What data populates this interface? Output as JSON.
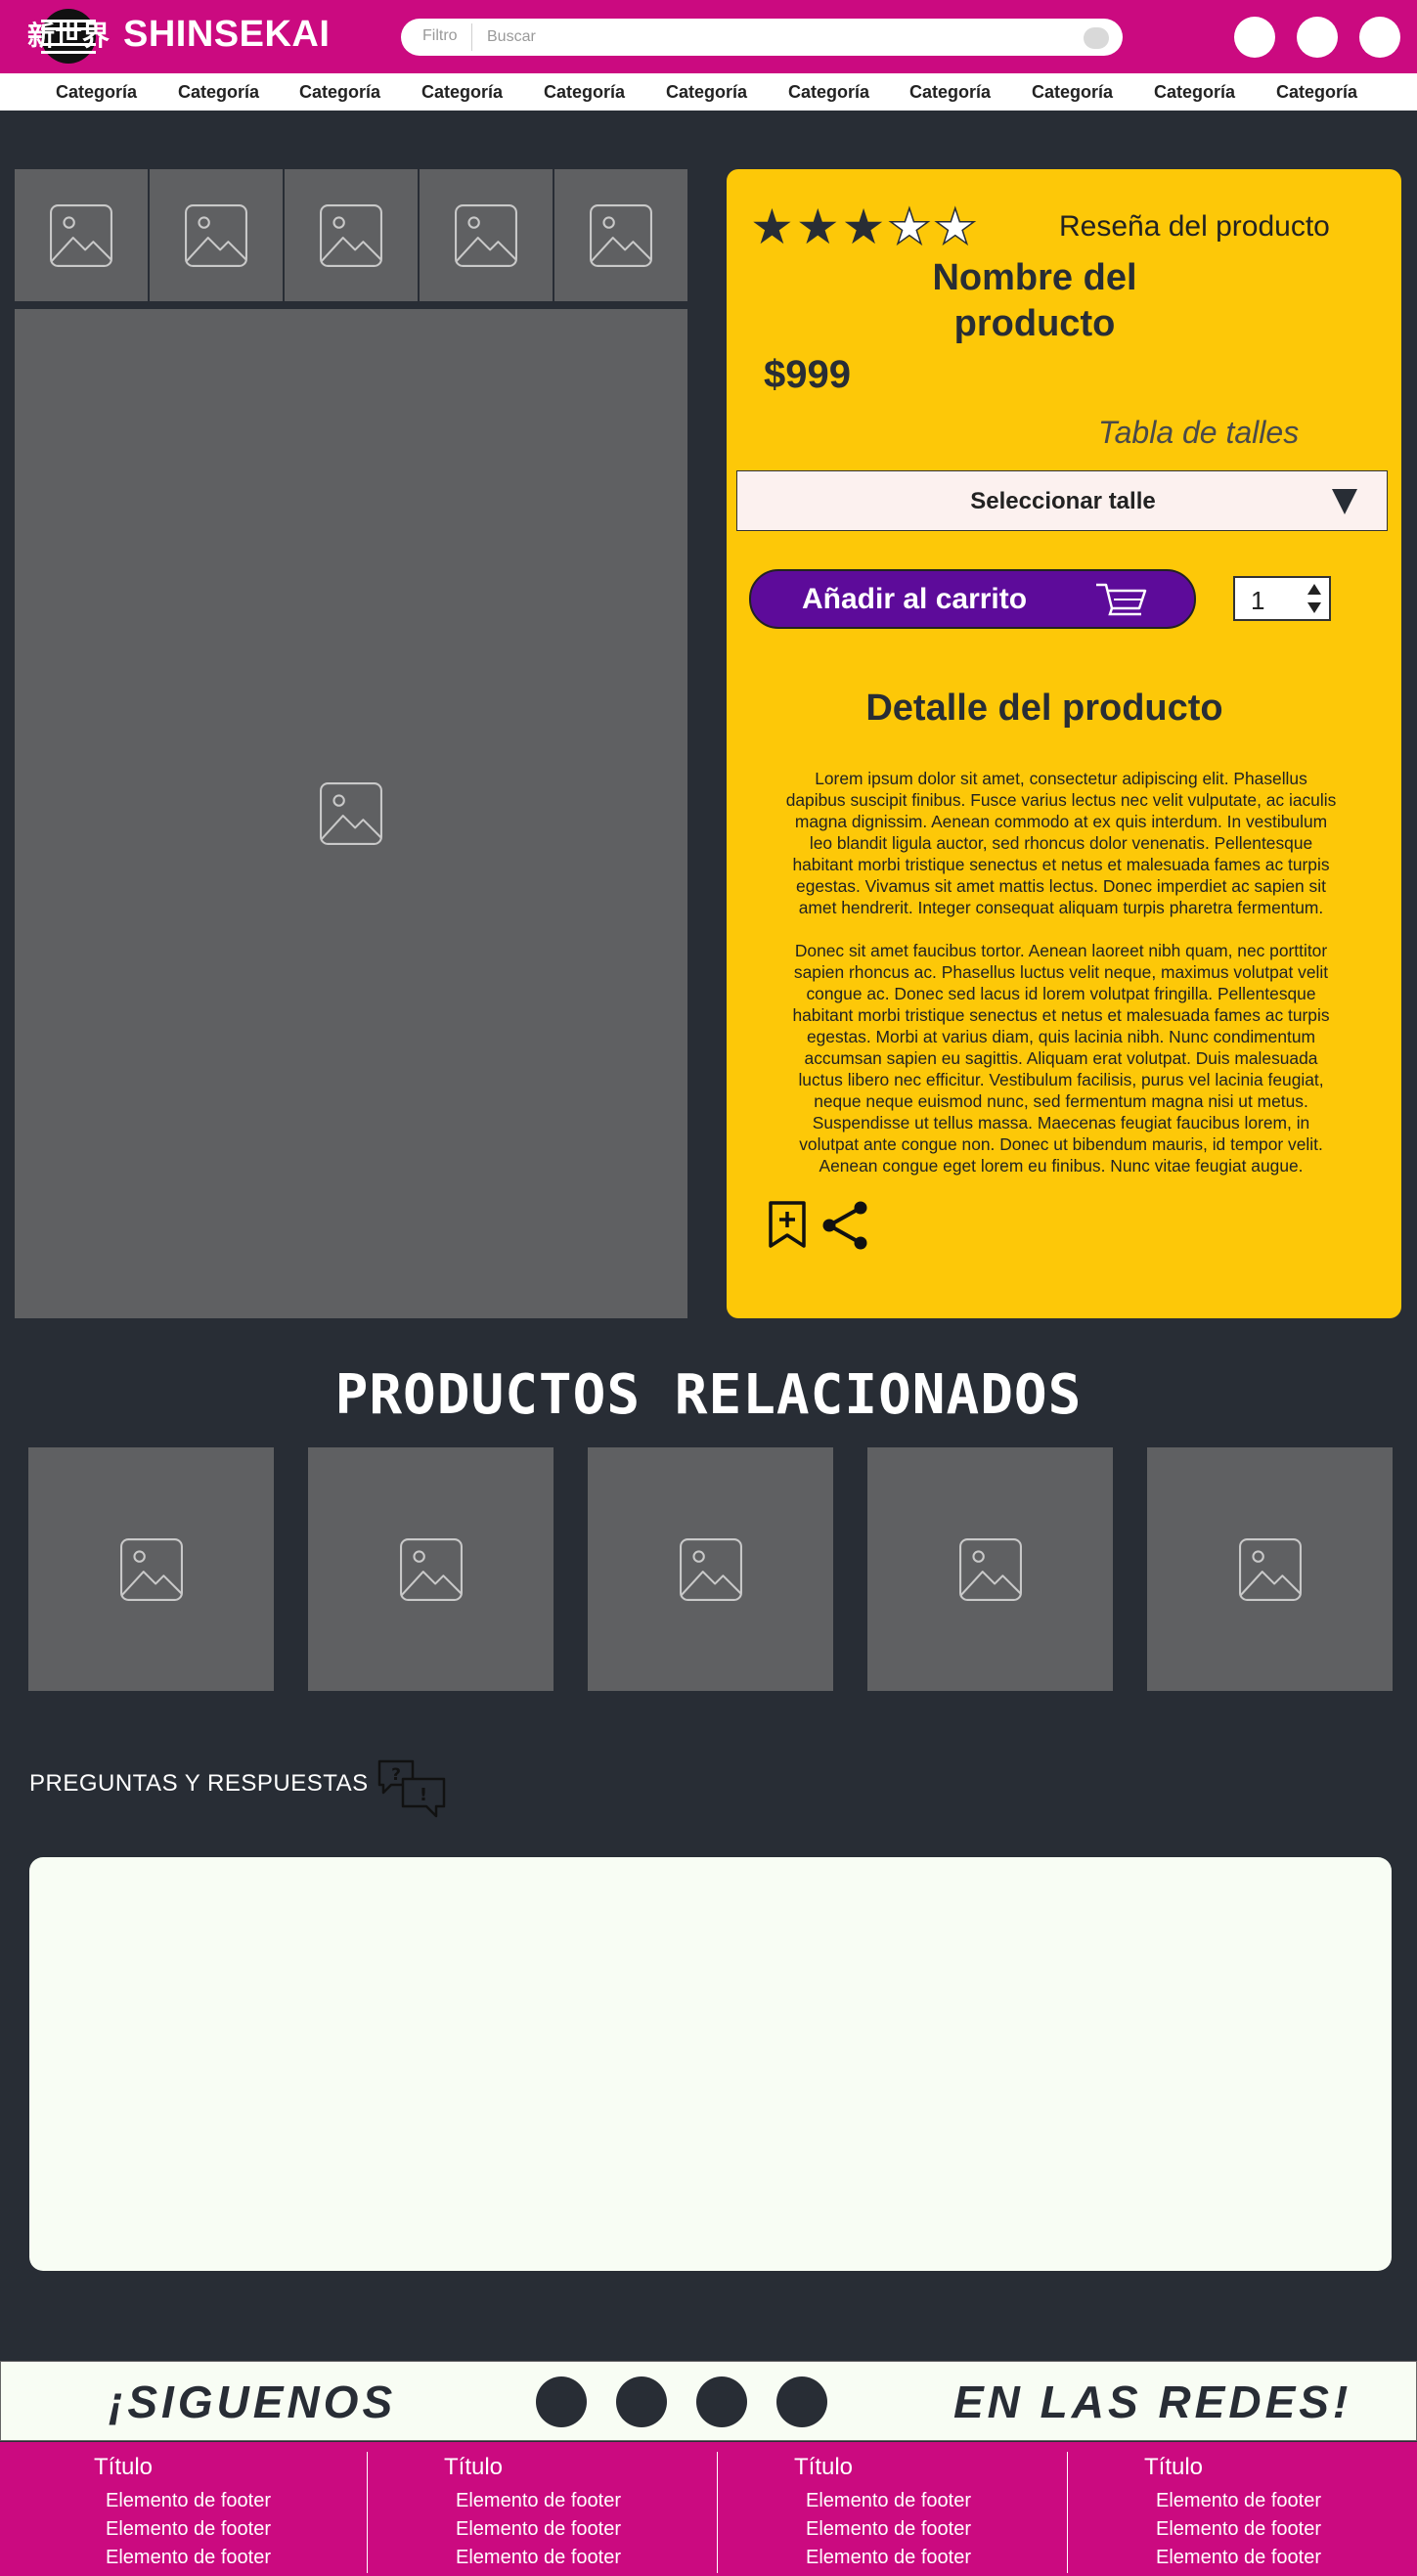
{
  "header": {
    "logo_text": "SHINSEKAI",
    "logo_kanji": "新世界",
    "search": {
      "filter_label": "Filtro",
      "placeholder": "Buscar"
    }
  },
  "categories": [
    "Categoría",
    "Categoría",
    "Categoría",
    "Categoría",
    "Categoría",
    "Categoría",
    "Categoría",
    "Categoría",
    "Categoría",
    "Categoría",
    "Categoría"
  ],
  "product": {
    "rating": 3,
    "rating_max": 5,
    "review_label": "Reseña del producto",
    "name_line1": "Nombre del",
    "name_line2": "producto",
    "price": "$999",
    "size_table": "Tabla de talles",
    "size_select": "Seleccionar talle",
    "add_to_cart": "Añadir al carrito",
    "quantity": "1",
    "detail_title": "Detalle del producto",
    "description": [
      [
        "Lorem ipsum dolor sit amet, consectetur adipiscing elit. Phasellus",
        "dapibus suscipit finibus. Fusce varius lectus nec velit vulputate, ac iaculis",
        "magna dignissim. Aenean commodo at ex quis interdum. In vestibulum",
        "leo blandit ligula auctor, sed rhoncus dolor venenatis. Pellentesque",
        "habitant morbi tristique senectus et netus et malesuada fames ac turpis",
        "egestas. Vivamus sit amet mattis lectus. Donec imperdiet ac sapien sit",
        "amet hendrerit. Integer consequat aliquam turpis pharetra fermentum."
      ],
      [
        "Donec sit amet faucibus tortor. Aenean laoreet nibh quam, nec porttitor",
        "sapien rhoncus ac. Phasellus luctus velit neque, maximus volutpat velit",
        "congue ac. Donec sed lacus id lorem volutpat fringilla. Pellentesque",
        "habitant morbi tristique senectus et netus et malesuada fames ac turpis",
        "egestas. Morbi at varius diam, quis lacinia nibh. Nunc condimentum",
        "accumsan sapien eu sagittis. Aliquam erat volutpat. Duis malesuada",
        "luctus libero nec efficitur. Vestibulum facilisis, purus vel lacinia feugiat,",
        "neque neque euismod nunc, sed fermentum magna nisi ut metus.",
        "Suspendisse ut tellus massa. Maecenas feugiat faucibus lorem, in",
        "volutpat ante congue non. Donec ut bibendum mauris, id tempor velit.",
        "Aenean congue eget lorem eu finibus. Nunc vitae feugiat augue."
      ]
    ]
  },
  "related": {
    "title": "PRODUCTOS RELACIONADOS",
    "count": 5
  },
  "qa": {
    "title": "PREGUNTAS Y RESPUESTAS"
  },
  "social": {
    "left": "¡SIGUENOS",
    "right": "EN LAS REDES!"
  },
  "footer": {
    "columns": [
      {
        "title": "Título",
        "items": [
          "Elemento de footer",
          "Elemento de footer",
          "Elemento de footer"
        ]
      },
      {
        "title": "Título",
        "items": [
          "Elemento de footer",
          "Elemento de footer",
          "Elemento de footer"
        ]
      },
      {
        "title": "Título",
        "items": [
          "Elemento de footer",
          "Elemento de footer",
          "Elemento de footer"
        ]
      },
      {
        "title": "Título",
        "items": [
          "Elemento de footer",
          "Elemento de footer",
          "Elemento de footer"
        ]
      }
    ]
  },
  "colors": {
    "brand_magenta": "#cb0a80",
    "background": "#282d35",
    "panel_yellow": "#fdc808",
    "cart_purple": "#5d0b9a",
    "placeholder_gray": "#5f6062"
  },
  "icons": [
    "image-placeholder-icon",
    "cart-icon",
    "bookmark-add-icon",
    "share-icon",
    "qa-chat-icon",
    "search-icon",
    "star-icon",
    "dropdown-arrow-icon"
  ]
}
